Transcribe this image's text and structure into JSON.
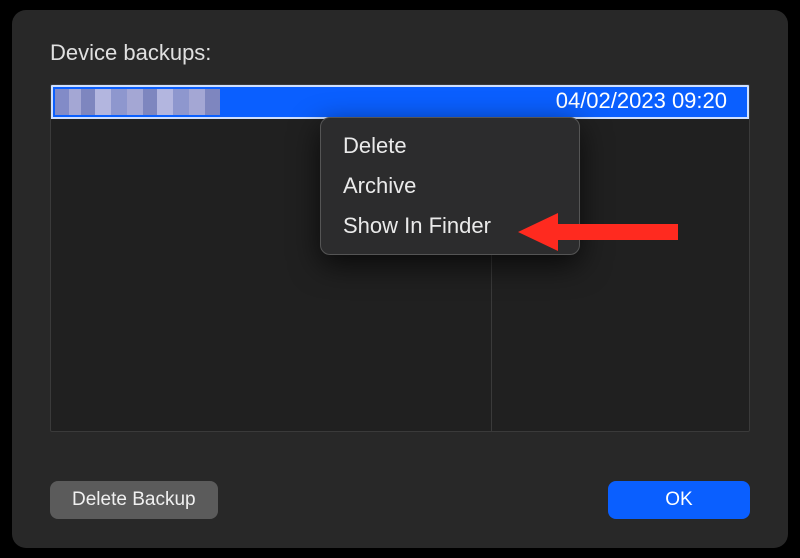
{
  "header": {
    "title": "Device backups:"
  },
  "list": {
    "rows": [
      {
        "name_redacted": true,
        "date": "04/02/2023 09:20"
      }
    ]
  },
  "context_menu": {
    "items": [
      {
        "label": "Delete"
      },
      {
        "label": "Archive"
      },
      {
        "label": "Show In Finder"
      }
    ]
  },
  "buttons": {
    "delete_backup": "Delete Backup",
    "ok": "OK"
  },
  "annotation": {
    "arrow_target": "Show In Finder",
    "arrow_color": "#ff2a1f"
  }
}
